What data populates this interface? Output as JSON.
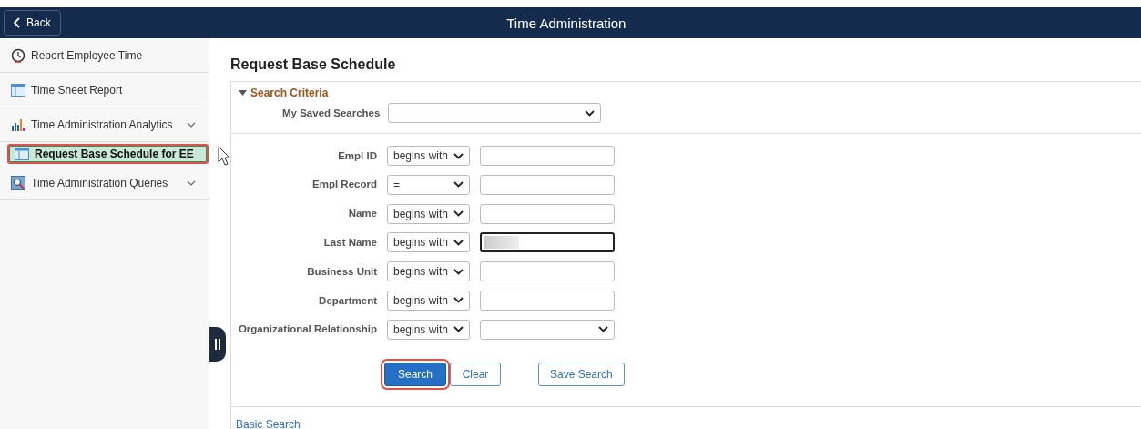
{
  "header": {
    "back_label": "Back",
    "title": "Time Administration"
  },
  "sidebar": {
    "items": [
      {
        "label": "Report Employee Time",
        "kind": "clock",
        "expandable": false,
        "selected": false
      },
      {
        "label": "Time Sheet Report",
        "kind": "page",
        "expandable": false,
        "selected": false
      },
      {
        "label": "Time Administration Analytics",
        "kind": "chart",
        "expandable": true,
        "selected": false
      },
      {
        "label": "Request Base Schedule for EE",
        "kind": "page",
        "expandable": false,
        "selected": true
      },
      {
        "label": "Time Administration Queries",
        "kind": "query",
        "expandable": true,
        "selected": false
      }
    ]
  },
  "page": {
    "title": "Request Base Schedule",
    "section_title": "Search Criteria",
    "expanded": true,
    "saved_searches_label": "My Saved Searches",
    "criteria": [
      {
        "label": "Empl ID",
        "operator": "begins with",
        "kind": "text",
        "focused": false,
        "redacted": false
      },
      {
        "label": "Empl Record",
        "operator": "=",
        "kind": "text",
        "focused": false,
        "redacted": false
      },
      {
        "label": "Name",
        "operator": "begins with",
        "kind": "text",
        "focused": false,
        "redacted": false
      },
      {
        "label": "Last Name",
        "operator": "begins with",
        "kind": "text",
        "focused": true,
        "redacted": true
      },
      {
        "label": "Business Unit",
        "operator": "begins with",
        "kind": "text",
        "focused": false,
        "redacted": false
      },
      {
        "label": "Department",
        "operator": "begins with",
        "kind": "text",
        "focused": false,
        "redacted": false
      },
      {
        "label": "Organizational Relationship",
        "operator": "begins with",
        "kind": "select",
        "focused": false,
        "redacted": false
      }
    ],
    "buttons": [
      {
        "label": "Search",
        "kind": "primary",
        "highlighted": true
      },
      {
        "label": "Clear",
        "kind": "secondary",
        "highlighted": false
      },
      {
        "label": "Save Search",
        "kind": "secondary",
        "highlighted": false
      }
    ],
    "basic_search_link": "Basic Search"
  }
}
